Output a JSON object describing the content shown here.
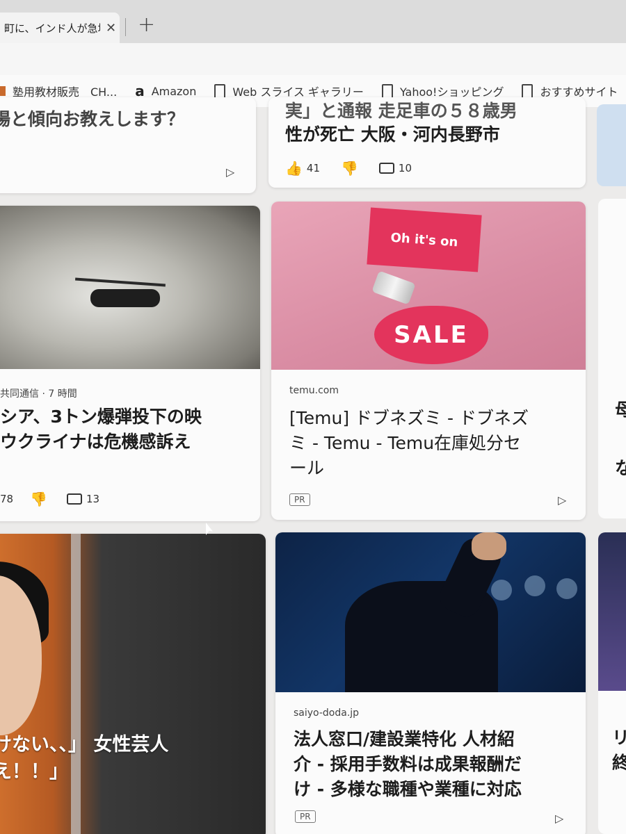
{
  "browser": {
    "tab_title": "町に、インド人が急増",
    "tab_close": "✕",
    "new_tab": "+",
    "bookmarks": [
      {
        "label": "塾用教材販売　CH...",
        "icon": "folder-icon"
      },
      {
        "label": "Amazon",
        "icon": "amazon-icon"
      },
      {
        "label": "Web スライス ギャラリー",
        "icon": "document-icon"
      },
      {
        "label": "Yahoo!ショッピング",
        "icon": "document-icon"
      },
      {
        "label": "おすすめサイト",
        "icon": "document-icon"
      }
    ]
  },
  "feed": {
    "top_left": {
      "title_tail": "場と傾向お教えします？"
    },
    "top_mid": {
      "title_line1": "実」と通報 走足車の５８歳男",
      "title_line2": "性が死亡 大阪・河内長野市",
      "likes": "41",
      "comments": "10"
    },
    "helicopter": {
      "source": "共同通信 · 7 時間",
      "title_line1": "シア、3トン爆弾投下の映",
      "title_line2": "ウクライナは危機感訴え",
      "likes": "78",
      "comments": "13"
    },
    "temu_ad": {
      "image_box_text": "Oh it's on",
      "image_sale_text": "SALE",
      "source": "temu.com",
      "title_line1": "[Temu] ドブネズミ - ドブネズ",
      "title_line2": "ミ - Temu - Temu在庫処分セ",
      "title_line3": "ール",
      "badge": "PR"
    },
    "person_card": {
      "title_line1": "けない、、」 女性芸人",
      "title_line2": "え！！」"
    },
    "doda_ad": {
      "source": "saiyo-doda.jp",
      "title_line1": "法人窓口/建設業特化 人材紹",
      "title_line2": "介 - 採用手数料は成果報酬だ",
      "title_line3": "け - 多様な職種や業種に対応",
      "badge": "PR"
    },
    "right_edge": {
      "fragment1": "母",
      "fragment2": "な",
      "fragment3": "リ",
      "fragment4": "終"
    }
  },
  "colors": {
    "sale_pink": "#e3345c",
    "ad_background": "#d98ca3",
    "business_navy": "#123566"
  }
}
